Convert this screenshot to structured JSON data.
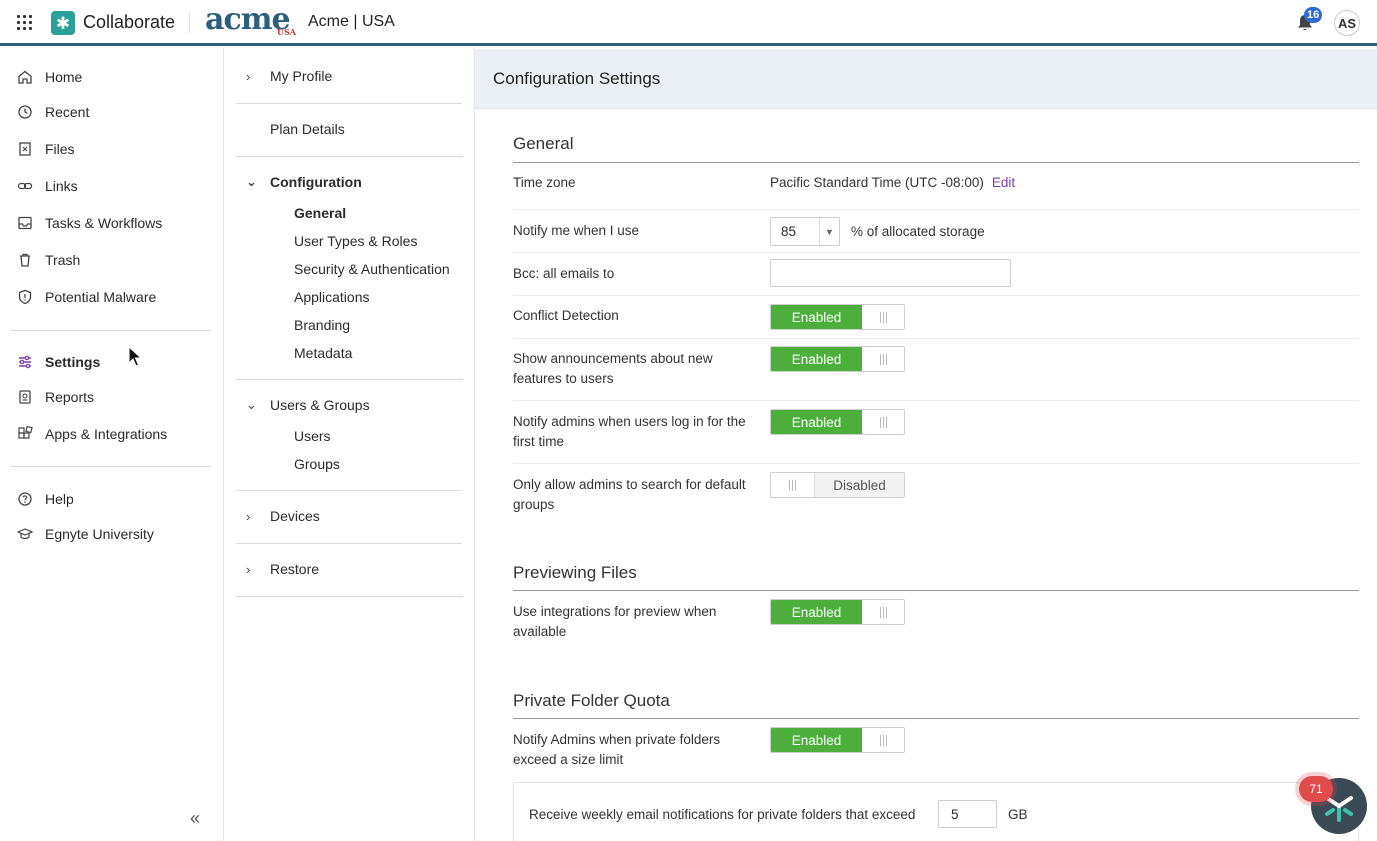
{
  "topbar": {
    "app_name": "Collaborate",
    "brand_logo": "acme",
    "brand_sub": "USA",
    "org_name": "Acme | USA",
    "notification_count": "16",
    "avatar_initials": "AS"
  },
  "sidebar": {
    "items": [
      {
        "label": "Home",
        "icon": "home-icon"
      },
      {
        "label": "Recent",
        "icon": "clock-icon"
      },
      {
        "label": "Files",
        "icon": "file-icon"
      },
      {
        "label": "Links",
        "icon": "link-icon"
      },
      {
        "label": "Tasks & Workflows",
        "icon": "inbox-icon"
      },
      {
        "label": "Trash",
        "icon": "trash-icon"
      },
      {
        "label": "Potential Malware",
        "icon": "shield-icon"
      },
      {
        "label": "Settings",
        "icon": "sliders-icon"
      },
      {
        "label": "Reports",
        "icon": "report-icon"
      },
      {
        "label": "Apps & Integrations",
        "icon": "apps-icon"
      },
      {
        "label": "Help",
        "icon": "help-icon"
      },
      {
        "label": "Egnyte University",
        "icon": "graduation-icon"
      }
    ],
    "active": "Settings",
    "accent_color": "#7b3fa0"
  },
  "midnav": {
    "my_profile": "My Profile",
    "plan_details": "Plan Details",
    "configuration": "Configuration",
    "configuration_items": [
      "General",
      "User Types & Roles",
      "Security & Authentication",
      "Applications",
      "Branding",
      "Metadata"
    ],
    "users_groups": "Users & Groups",
    "users_groups_items": [
      "Users",
      "Groups"
    ],
    "devices": "Devices",
    "restore": "Restore"
  },
  "main": {
    "title": "Configuration Settings",
    "general": {
      "title": "General",
      "time_zone_label": "Time zone",
      "time_zone_value": "Pacific Standard Time (UTC -08:00)",
      "edit_label": "Edit",
      "notify_label": "Notify me when I use",
      "notify_value": "85",
      "notify_suffix": "% of allocated storage",
      "bcc_label": "Bcc: all emails to",
      "bcc_value": "",
      "conflict_label": "Conflict Detection",
      "announce_label": "Show announcements about new features to users",
      "notify_admins_label": "Notify admins when users log in for the first time",
      "only_admins_label": "Only allow admins to search for default groups"
    },
    "previewing": {
      "title": "Previewing Files",
      "integrations_label": "Use integrations for preview when available"
    },
    "quota": {
      "title": "Private Folder Quota",
      "notify_label": "Notify Admins when private folders exceed a size limit",
      "weekly_label": "Receive weekly email notifications for private folders that exceed",
      "weekly_value": "5",
      "weekly_unit": "GB"
    },
    "toggle_enabled": "Enabled",
    "toggle_disabled": "Disabled",
    "enabled_color": "#4caf3c"
  },
  "helper": {
    "badge": "71"
  }
}
